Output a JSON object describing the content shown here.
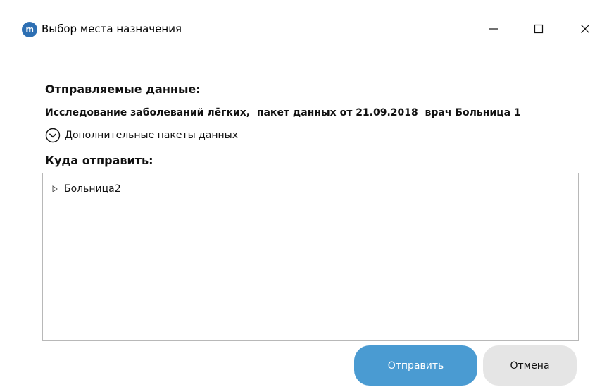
{
  "window": {
    "app_icon_text": "m",
    "title": "Выбор места назначения",
    "controls": {
      "minimize": "minimize",
      "maximize": "maximize",
      "close": "close"
    }
  },
  "sent_data": {
    "label": "Отправляемые данные:",
    "description": "Исследование заболеваний лёгких,  пакет данных от 21.09.2018  врач Больница 1"
  },
  "extra_packets": {
    "label": "Дополнительные пакеты данных",
    "icon": "chevron-down-circle-icon"
  },
  "destination": {
    "label": "Куда отправить:",
    "tree": [
      {
        "label": "Больница2",
        "icon": "expand-arrow-icon"
      }
    ]
  },
  "buttons": {
    "send": "Отправить",
    "cancel": "Отмена"
  },
  "colors": {
    "primary_button": "#4a9bd2",
    "secondary_button": "#e5e5e5",
    "app_icon": "#2d6fb3"
  }
}
